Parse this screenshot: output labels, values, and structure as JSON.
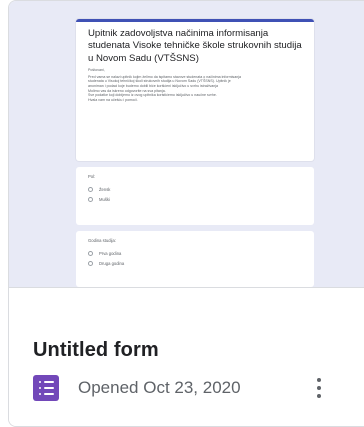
{
  "thumbnail": {
    "form_title": "Upitnik zadovoljstva načinima informisanja studenata Visoke tehničke škole strukovnih studija u Novom Sadu (VTŠSNS)",
    "subtitle": "Poštovani,",
    "intro_lines": [
      "Pred vama se nalazi upitnik kojim želimo da ispitamo stavove studenata o načinima informisanja",
      "studenata u Visokoj tehničkoj školi strukovnih studija u Novom Sadu (VTŠSNS). Upitnik je",
      "anoniman i podaci koje budemo dobili biće korišćeni isključivo u svrhu istraživanja",
      "Molimo vas da iskreno odgovorite na sva pitanja.",
      "Sve podatke koji dobijemo iz ovog upitnika koristićemo isključivo u naučne svrhe.",
      "Hvala vam na učešću i pomoći."
    ],
    "q1": {
      "label": "Pol:",
      "options": [
        "Žensk",
        "Muški"
      ]
    },
    "q2": {
      "label": "Godina studija:",
      "options": [
        "Prva godina",
        "Druga godina"
      ]
    },
    "accent": "#3f51b5",
    "background": "#e8eaf6"
  },
  "file": {
    "title": "Untitled form",
    "opened": "Opened Oct 23, 2020",
    "icon": "google-forms-icon",
    "icon_color": "#7248b9",
    "menu_icon": "more-vert-icon"
  }
}
